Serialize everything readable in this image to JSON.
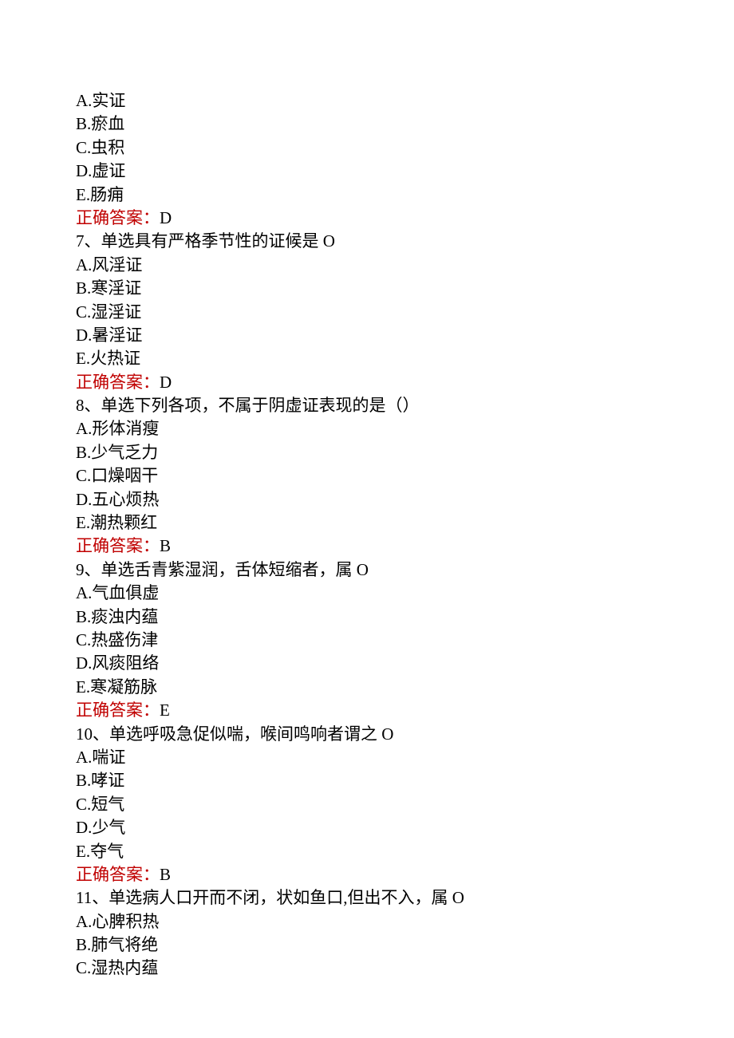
{
  "questions": [
    {
      "number": "",
      "stem": "",
      "options": [
        {
          "letter": "A",
          "text": "实证"
        },
        {
          "letter": "B",
          "text": "瘀血"
        },
        {
          "letter": "C",
          "text": "虫积"
        },
        {
          "letter": "D",
          "text": "虚证"
        },
        {
          "letter": "E",
          "text": "肠痈"
        }
      ],
      "answer_label": "正确答案：",
      "answer_value": "D"
    },
    {
      "number": "7、",
      "stem": "单选具有严格季节性的证候是 O",
      "options": [
        {
          "letter": "A",
          "text": "风淫证"
        },
        {
          "letter": "B",
          "text": "寒淫证"
        },
        {
          "letter": "C",
          "text": "湿淫证"
        },
        {
          "letter": "D",
          "text": "暑淫证"
        },
        {
          "letter": "E",
          "text": "火热证"
        }
      ],
      "answer_label": "正确答案：",
      "answer_value": "D"
    },
    {
      "number": "8、",
      "stem": "单选下列各项，不属于阴虚证表现的是（）",
      "options": [
        {
          "letter": "A",
          "text": "形体消瘦"
        },
        {
          "letter": "B",
          "text": "少气乏力"
        },
        {
          "letter": "C",
          "text": "口燥咽干"
        },
        {
          "letter": "D",
          "text": "五心烦热"
        },
        {
          "letter": "E",
          "text": "潮热颗红"
        }
      ],
      "answer_label": "正确答案：",
      "answer_value": "B"
    },
    {
      "number": "9、",
      "stem": "单选舌青紫湿润，舌体短缩者，属 O",
      "options": [
        {
          "letter": "A",
          "text": "气血俱虚"
        },
        {
          "letter": "B",
          "text": "痰浊内蕴"
        },
        {
          "letter": "C",
          "text": "热盛伤津"
        },
        {
          "letter": "D",
          "text": "风痰阻络"
        },
        {
          "letter": "E",
          "text": "寒凝筋脉"
        }
      ],
      "answer_label": "正确答案：",
      "answer_value": "E"
    },
    {
      "number": "10、",
      "stem": "单选呼吸急促似喘，喉间鸣响者谓之 O",
      "options": [
        {
          "letter": "A",
          "text": "喘证"
        },
        {
          "letter": "B",
          "text": "哮证"
        },
        {
          "letter": "C",
          "text": "短气"
        },
        {
          "letter": "D",
          "text": "少气"
        },
        {
          "letter": "E",
          "text": "夺气"
        }
      ],
      "answer_label": "正确答案：",
      "answer_value": "B"
    },
    {
      "number": "11、",
      "stem": "单选病人口开而不闭，状如鱼口,但出不入，属 O",
      "options": [
        {
          "letter": "A",
          "text": "心脾积热"
        },
        {
          "letter": "B",
          "text": "肺气将绝"
        },
        {
          "letter": "C",
          "text": "湿热内蕴"
        }
      ],
      "answer_label": "",
      "answer_value": ""
    }
  ]
}
